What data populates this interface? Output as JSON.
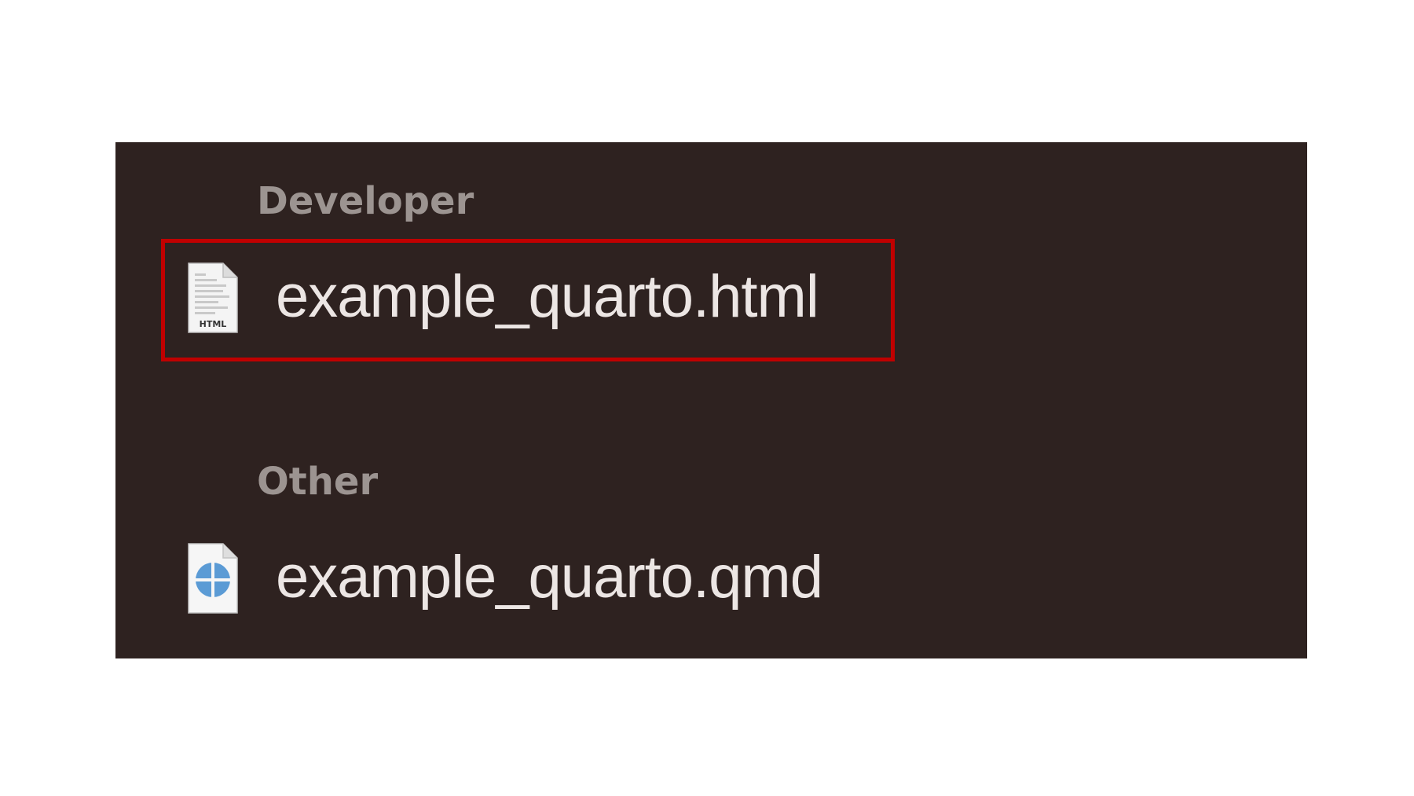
{
  "sections": [
    {
      "header": "Developer",
      "files": [
        {
          "name": "example_quarto.html",
          "icon": "html-file-icon",
          "icon_label": "HTML",
          "highlighted": true
        }
      ]
    },
    {
      "header": "Other",
      "files": [
        {
          "name": "example_quarto.qmd",
          "icon": "quarto-file-icon",
          "highlighted": false
        }
      ]
    }
  ],
  "colors": {
    "panel_background": "#2e2220",
    "header_text": "#9c9491",
    "file_text": "#ece6e4",
    "highlight_border": "#c00000",
    "quarto_blue": "#5b9bd5"
  }
}
